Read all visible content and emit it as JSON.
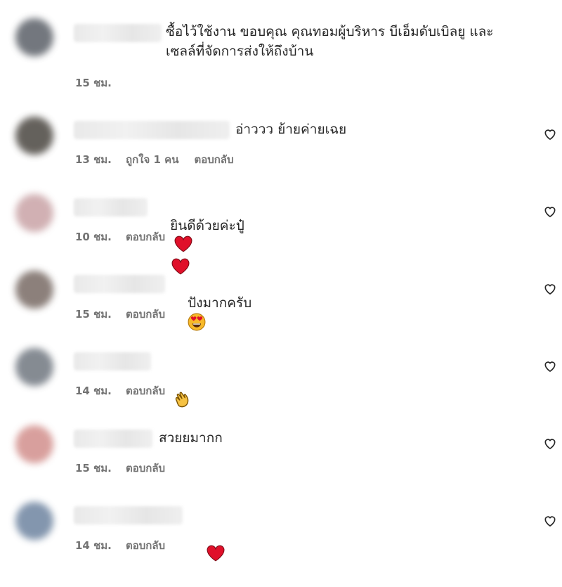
{
  "comments": [
    {
      "text": "ซื้อไว้ใช้งาน ขอบคุณ คุณทอมผู้บริหาร บีเอ็มดับเบิลยู และ\nเซลล์ที่จัดการส่งให้ถึงบ้าน",
      "time": "15 ชม.",
      "likes": "",
      "reply": "",
      "avatar_color": "#5b6068"
    },
    {
      "text": "อ่าววว ย้ายค่ายเฉย",
      "time": "13 ชม.",
      "likes": "ถูกใจ 1 คน",
      "reply": "ตอบกลับ",
      "avatar_color": "#4a4640"
    },
    {
      "text": "ยินดีด้วยค่ะปู๋",
      "time": "10 ชม.",
      "likes": "",
      "reply": "ตอบกลับ",
      "avatar_color": "#c9a3a6",
      "emoji": [
        "red-heart",
        "red-heart"
      ]
    },
    {
      "text": "ปังมากครับ",
      "time": "15 ชม.",
      "likes": "",
      "reply": "ตอบกลับ",
      "avatar_color": "#786a64",
      "emoji": [
        "heart-eyes"
      ]
    },
    {
      "text": "",
      "time": "14 ชม.",
      "likes": "",
      "reply": "ตอบกลับ",
      "avatar_color": "#707780",
      "emoji": [
        "clapping-hands"
      ]
    },
    {
      "text": "สวยยมากก",
      "time": "15 ชม.",
      "likes": "",
      "reply": "ตอบกลับ",
      "avatar_color": "#d28f8c"
    },
    {
      "text": "",
      "time": "14 ชม.",
      "likes": "",
      "reply": "ตอบกลับ",
      "avatar_color": "#6e84a0",
      "emoji": [
        "red-heart"
      ]
    }
  ],
  "icons": {
    "like": "heart-outline-icon",
    "heart_color": "#e0102a"
  }
}
